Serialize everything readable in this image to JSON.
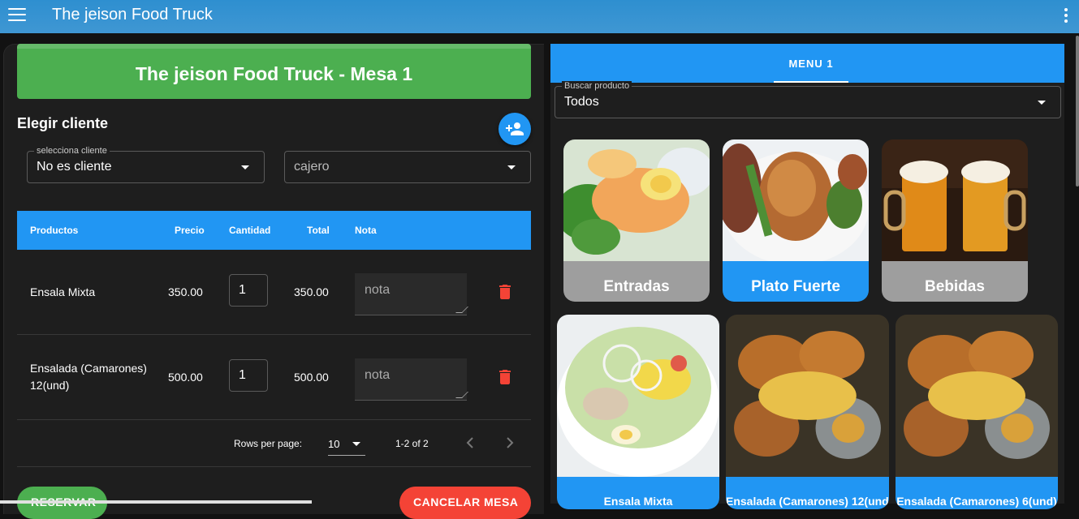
{
  "app_bar": {
    "title": "The jeison Food Truck"
  },
  "order": {
    "header": "The jeison Food Truck - Mesa 1",
    "choose_client_label": "Elegir cliente",
    "client_select": {
      "legend": "selecciona cliente",
      "value": "No es cliente"
    },
    "cashier_select": {
      "value": "cajero"
    },
    "table": {
      "columns": [
        "Productos",
        "Precio",
        "Cantidad",
        "Total",
        "Nota"
      ],
      "rows": [
        {
          "product": "Ensala Mixta",
          "price": "350.00",
          "quantity": "1",
          "total": "350.00",
          "note_placeholder": "nota"
        },
        {
          "product": "Ensalada (Camarones) 12(und)",
          "price": "500.00",
          "quantity": "1",
          "total": "500.00",
          "note_placeholder": "nota"
        }
      ],
      "pagination": {
        "rows_per_page_label": "Rows per page:",
        "rows_per_page": "10",
        "range": "1-2 of 2"
      }
    },
    "buttons": {
      "reserve": "RESERVAR",
      "cancel": "CANCELAR MESA"
    }
  },
  "menu": {
    "tabs": [
      {
        "label": "MENU 1",
        "active": true
      }
    ],
    "search": {
      "legend": "Buscar producto",
      "value": "Todos"
    },
    "categories": [
      {
        "label": "Entradas",
        "active": false
      },
      {
        "label": "Plato Fuerte",
        "active": true
      },
      {
        "label": "Bebidas",
        "active": false
      }
    ],
    "products": [
      {
        "label": "Ensala Mixta"
      },
      {
        "label": "Ensalada (Camarones) 12(und)"
      },
      {
        "label": "Ensalada (Camarones) 6(und)"
      }
    ]
  },
  "colors": {
    "app_bar": "#3392d1",
    "primary": "#2196f3",
    "success": "#4caf50",
    "danger": "#f44336",
    "inactive_label": "#9e9e9e",
    "surface": "#1e1e1e"
  }
}
